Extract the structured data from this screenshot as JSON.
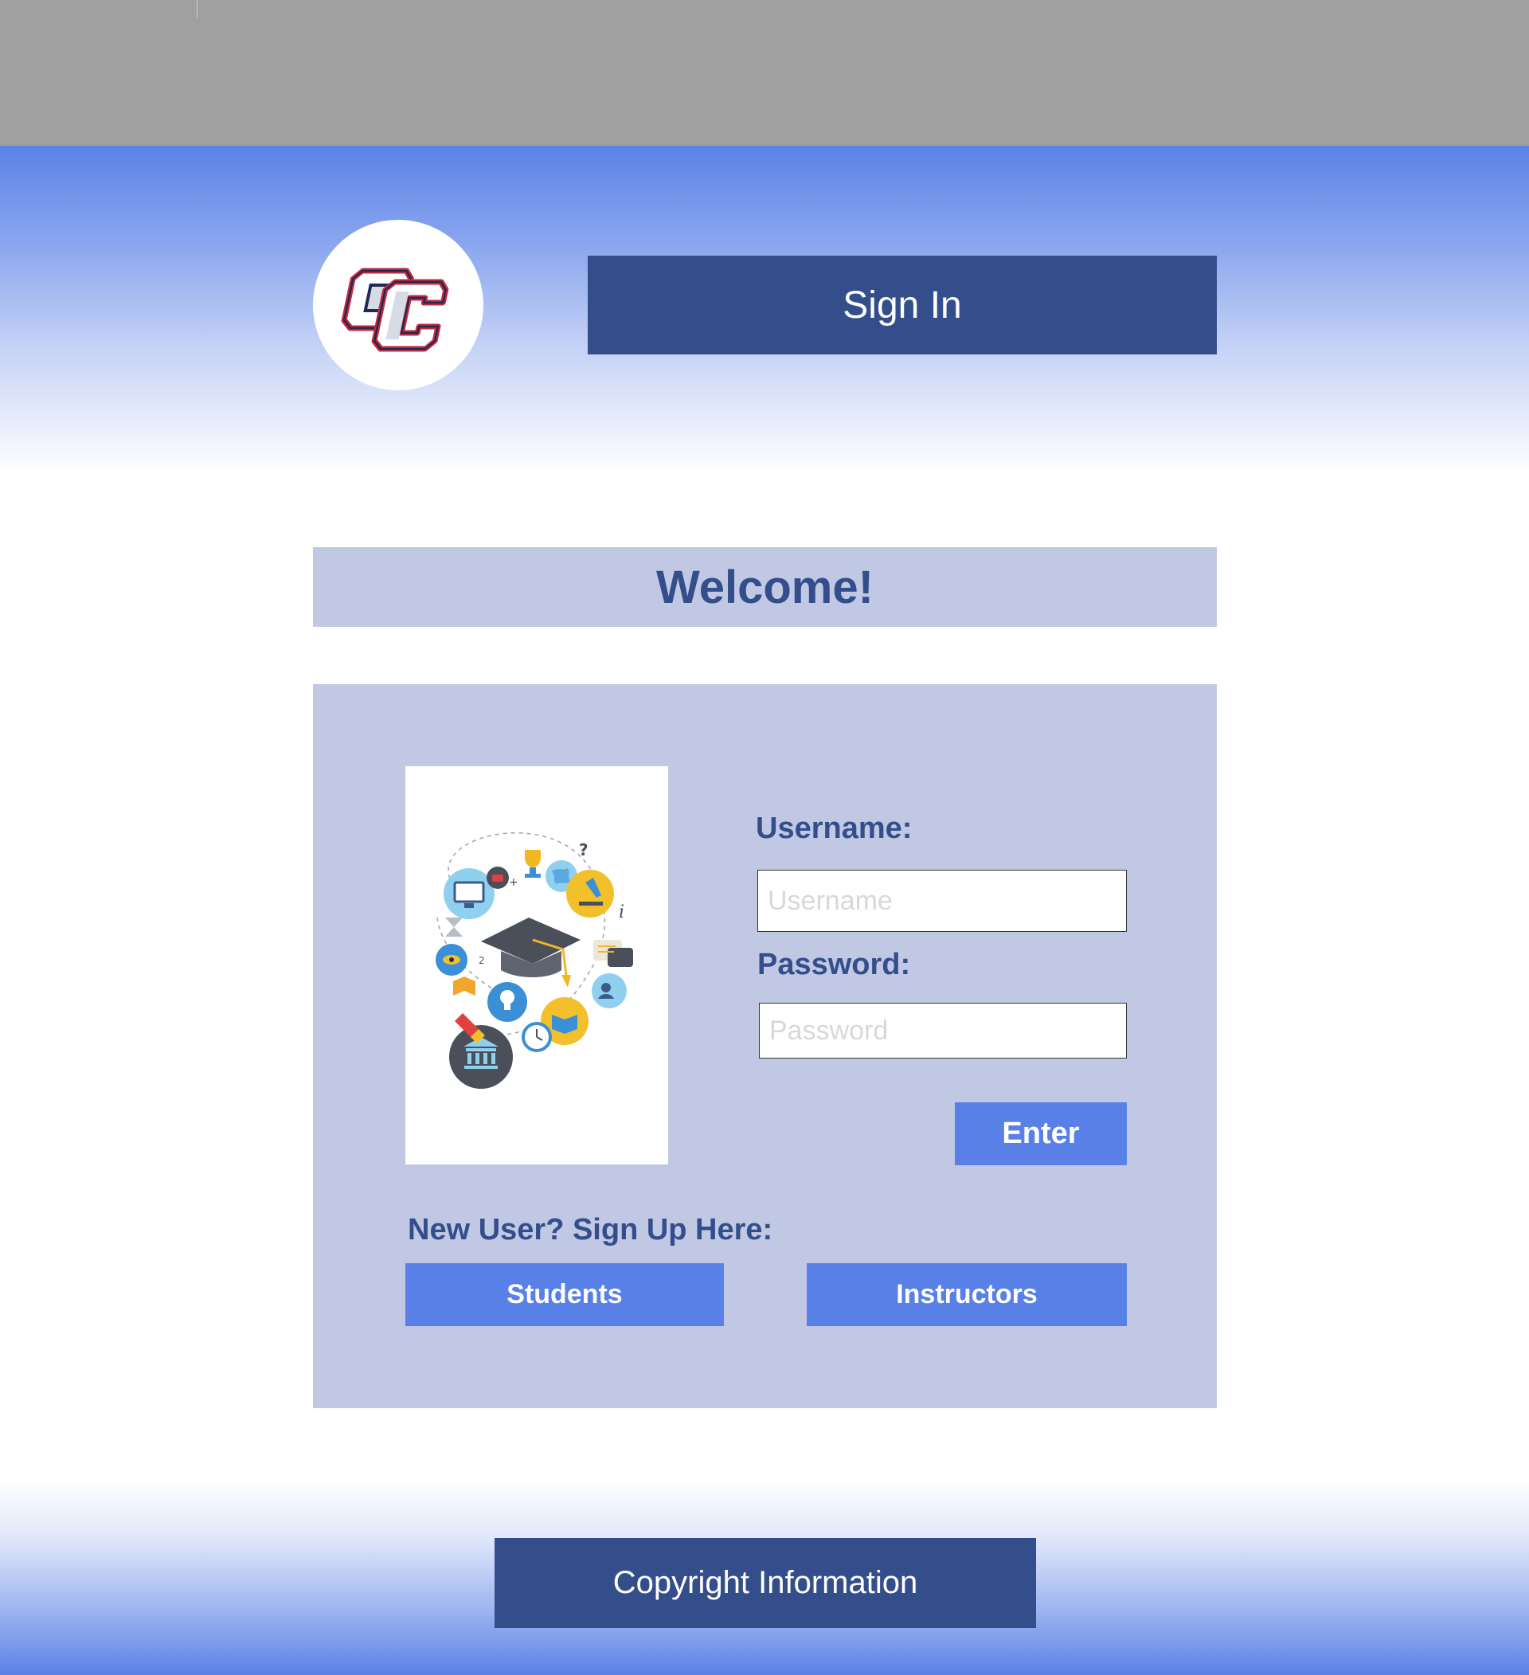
{
  "header": {
    "signin_label": "Sign In"
  },
  "welcome": {
    "title": "Welcome!"
  },
  "login": {
    "username_label": "Username:",
    "username_placeholder": "Username",
    "password_label": "Password:",
    "password_placeholder": "Password",
    "enter_label": "Enter"
  },
  "signup": {
    "prompt": "New User? Sign Up Here:",
    "students_label": "Students",
    "instructors_label": "Instructors"
  },
  "footer": {
    "copyright_label": "Copyright Information"
  },
  "colors": {
    "navy": "#344e8c",
    "accent_blue": "#5880e6",
    "panel": "#c1c8e4",
    "topbar": "#a0a0a0",
    "logo_red": "#c8283c"
  },
  "icons": {
    "logo": "qc-logo-icon",
    "illustration": "graduation-education-illustration"
  }
}
